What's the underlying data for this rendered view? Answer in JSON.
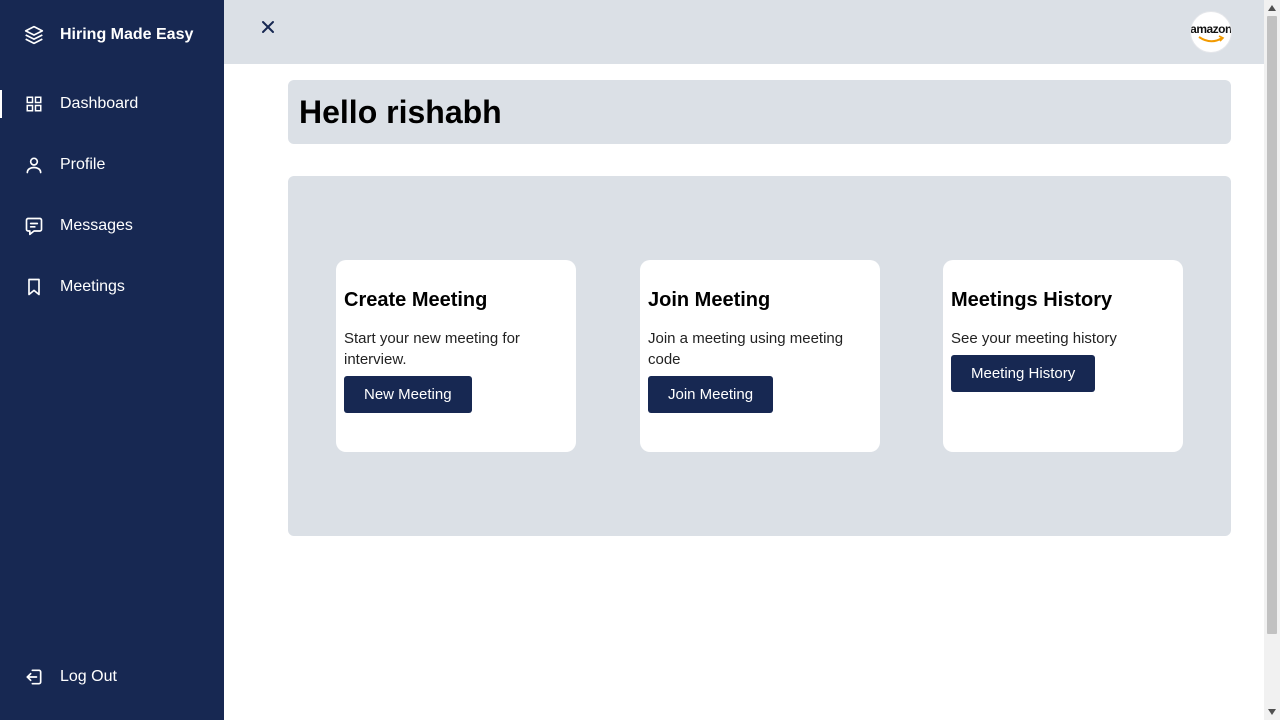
{
  "app": {
    "brand_name": "Hiring Made Easy"
  },
  "sidebar": {
    "items": [
      {
        "label": "Dashboard",
        "icon": "grid-icon"
      },
      {
        "label": "Profile",
        "icon": "user-icon"
      },
      {
        "label": "Messages",
        "icon": "message-icon"
      },
      {
        "label": "Meetings",
        "icon": "bookmark-icon"
      }
    ],
    "logout_label": "Log Out"
  },
  "header": {
    "avatar_text": "amazon"
  },
  "main": {
    "greeting": "Hello rishabh",
    "cards": [
      {
        "title": "Create Meeting",
        "description": "Start your new meeting for interview.",
        "button": "New Meeting"
      },
      {
        "title": "Join Meeting",
        "description": "Join a meeting using meeting code",
        "button": "Join Meeting"
      },
      {
        "title": "Meetings History",
        "description": "See your meeting history",
        "button": "Meeting History"
      }
    ]
  },
  "colors": {
    "sidebar_bg": "#172852",
    "panel_bg": "#dbe0e6",
    "button_bg": "#172852"
  }
}
